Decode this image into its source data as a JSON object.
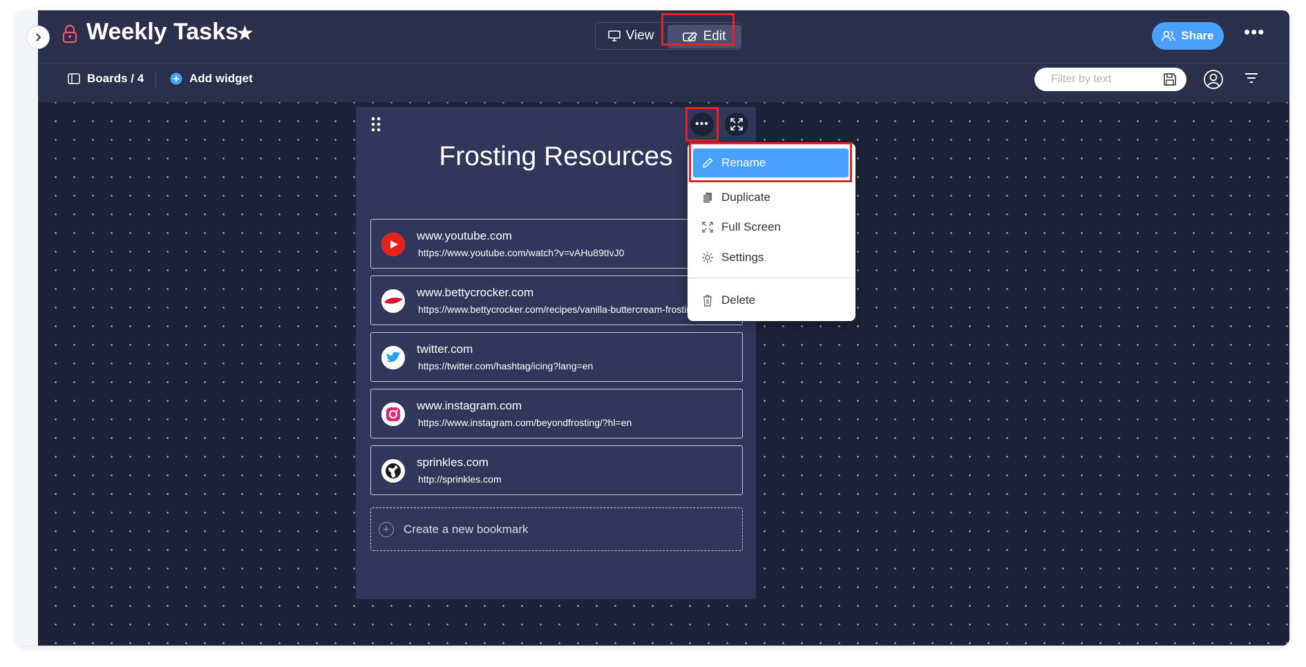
{
  "header": {
    "board_title": "Weekly Tasks",
    "view_label": "View",
    "edit_label": "Edit",
    "share_label": "Share"
  },
  "toolbar": {
    "boards_label": "Boards / 4",
    "add_widget_label": "Add widget",
    "filter_placeholder": "Filter by text"
  },
  "widget": {
    "title": "Frosting Resources",
    "bookmarks": [
      {
        "domain": "www.youtube.com",
        "url": "https://www.youtube.com/watch?v=vAHu89tIvJ0",
        "icon": "youtube-icon"
      },
      {
        "domain": "www.bettycrocker.com",
        "url": "https://www.bettycrocker.com/recipes/vanilla-buttercream-frosting",
        "icon": "bettycrocker-icon"
      },
      {
        "domain": "twitter.com",
        "url": "https://twitter.com/hashtag/icing?lang=en",
        "icon": "twitter-icon"
      },
      {
        "domain": "www.instagram.com",
        "url": "https://www.instagram.com/beyondfrosting/?hl=en",
        "icon": "instagram-icon"
      },
      {
        "domain": "sprinkles.com",
        "url": "http://sprinkles.com",
        "icon": "globe-icon"
      }
    ],
    "new_bookmark_label": "Create a new bookmark"
  },
  "context_menu": {
    "items": [
      {
        "label": "Rename",
        "icon": "pencil-icon"
      },
      {
        "label": "Duplicate",
        "icon": "copy-icon"
      },
      {
        "label": "Full Screen",
        "icon": "fullscreen-icon"
      },
      {
        "label": "Settings",
        "icon": "gear-icon"
      },
      {
        "label": "Delete",
        "icon": "trash-icon"
      }
    ]
  },
  "colors": {
    "canvas": "#1e2238",
    "bar": "#2a2f4b",
    "widget": "#30375a",
    "accent": "#4aa0ff",
    "highlight": "#e8231b"
  }
}
